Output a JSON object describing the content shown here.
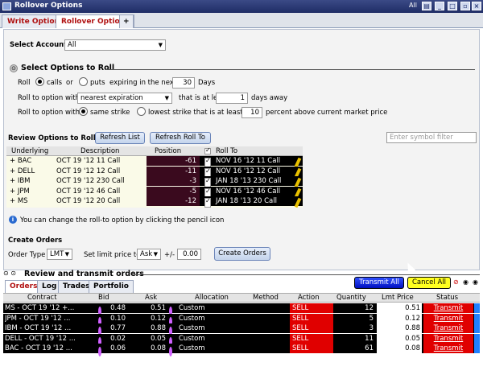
{
  "window": {
    "title": "Rollover Options",
    "right_label": "All"
  },
  "tabs": [
    {
      "label": "Write Options"
    },
    {
      "label": "Rollover Options"
    },
    {
      "label": "+"
    }
  ],
  "account": {
    "label": "Select Account",
    "value": "All"
  },
  "select_options": {
    "heading": "Select Options to Roll",
    "roll_label": "Roll",
    "calls_label": "calls",
    "or_label": "or",
    "puts_label": "puts",
    "expiring_label": "expiring in the next",
    "days_value": "30",
    "days_label": "Days",
    "roll_to_label": "Roll to option with",
    "expiration_value": "nearest expiration",
    "at_least_label": "that is at least",
    "days_away_value": "1",
    "days_away_label": "days away",
    "roll_to_label2": "Roll to option with",
    "same_strike_label": "same strike",
    "lowest_strike_label": "lowest strike that is at least",
    "percent_value": "10",
    "percent_label": "percent above current market price"
  },
  "review": {
    "heading": "Review Options to Roll",
    "refresh_list": "Refresh List",
    "refresh_roll_to": "Refresh Roll To",
    "filter_placeholder": "Enter symbol filter",
    "columns": {
      "underlying": "Underlying",
      "description": "Description",
      "position": "Position",
      "roll_to": "Roll To"
    },
    "rows": [
      {
        "underlying": "+ BAC",
        "description": "OCT 19 '12 11 Call",
        "position": "-61",
        "roll_to": "NOV 16 '12 11 Call"
      },
      {
        "underlying": "+ DELL",
        "description": "OCT 19 '12 12 Call",
        "position": "-11",
        "roll_to": "NOV 16 '12 12 Call"
      },
      {
        "underlying": "+ IBM",
        "description": "OCT 19 '12 230 Call",
        "position": "-3",
        "roll_to": "JAN 18 '13 230 Call"
      },
      {
        "underlying": "+ JPM",
        "description": "OCT 19 '12 46 Call",
        "position": "-5",
        "roll_to": "NOV 16 '12 46 Call"
      },
      {
        "underlying": "+ MS",
        "description": "OCT 19 '12 20 Call",
        "position": "-12",
        "roll_to": "JAN 18 '13 20 Call"
      }
    ],
    "info_text": "You can change the roll-to option by clicking the pencil icon"
  },
  "create_orders": {
    "heading": "Create Orders",
    "order_type_label": "Order Type",
    "order_type_value": "LMT",
    "limit_label": "Set limit price to",
    "limit_value": "Ask",
    "plus_minus_label": "+/-",
    "offset_value": "0.00",
    "button": "Create Orders"
  },
  "transmit_section": {
    "heading": "Review and transmit orders"
  },
  "bottom_tabs": [
    {
      "label": "Orders"
    },
    {
      "label": "Log"
    },
    {
      "label": "Trades"
    },
    {
      "label": "Portfolio"
    }
  ],
  "transmit_all": "Transmit All",
  "cancel_all": "Cancel All",
  "orders": {
    "columns": {
      "contract": "Contract",
      "bid": "Bid",
      "ask": "Ask",
      "allocation": "Allocation",
      "method": "Method",
      "action": "Action",
      "quantity": "Quantity",
      "lmt_price": "Lmt Price",
      "status": "Status"
    },
    "rows": [
      {
        "contract": "MS - OCT 19 '12 +...",
        "bid": "0.48",
        "ask": "0.51",
        "allocation": "Custom",
        "action": "SELL",
        "quantity": "12",
        "lmt_price": "0.51",
        "status": "Transmit"
      },
      {
        "contract": "JPM - OCT 19 '12 ...",
        "bid": "0.10",
        "ask": "0.12",
        "allocation": "Custom",
        "action": "SELL",
        "quantity": "5",
        "lmt_price": "0.12",
        "status": "Transmit"
      },
      {
        "contract": "IBM - OCT 19 '12 ...",
        "bid": "0.77",
        "ask": "0.88",
        "allocation": "Custom",
        "action": "SELL",
        "quantity": "3",
        "lmt_price": "0.88",
        "status": "Transmit"
      },
      {
        "contract": "DELL - OCT 19 '12 ...",
        "bid": "0.02",
        "ask": "0.05",
        "allocation": "Custom",
        "action": "SELL",
        "quantity": "11",
        "lmt_price": "0.05",
        "status": "Transmit"
      },
      {
        "contract": "BAC - OCT 19 '12 ...",
        "bid": "0.06",
        "ask": "0.08",
        "allocation": "Custom",
        "action": "SELL",
        "quantity": "61",
        "lmt_price": "0.08",
        "status": "Transmit"
      }
    ]
  }
}
